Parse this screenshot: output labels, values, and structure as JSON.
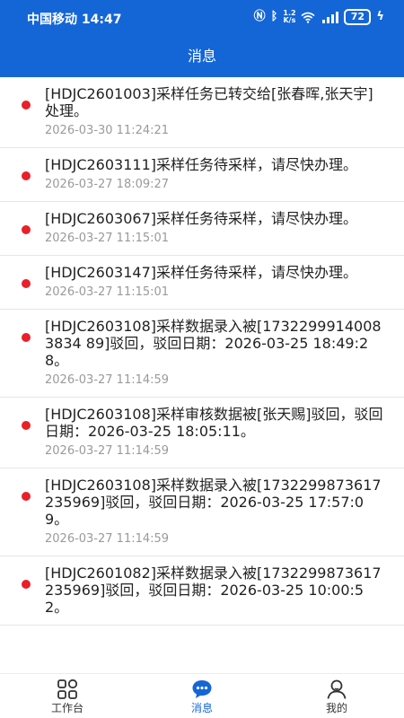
{
  "status_bar": {
    "carrier_time": "中国移动 14:47",
    "net_speed_top": "1.2",
    "net_speed_bottom": "K/s",
    "battery": "72"
  },
  "header": {
    "title": "消息"
  },
  "messages": [
    {
      "text": "[HDJC2601003]采样任务已转交给[张春晖,张天宇]处理。",
      "time": "2026-03-30 11:24:21"
    },
    {
      "text": "[HDJC2603111]采样任务待采样，请尽快办理。",
      "time": "2026-03-27 18:09:27"
    },
    {
      "text": "[HDJC2603067]采样任务待采样，请尽快办理。",
      "time": "2026-03-27 11:15:01"
    },
    {
      "text": "[HDJC2603147]采样任务待采样，请尽快办理。",
      "time": "2026-03-27 11:15:01"
    },
    {
      "text": "[HDJC2603108]采样数据录入被[17322999140083834 89]驳回，驳回日期：2026-03-25 18:49:28。",
      "time": "2026-03-27 11:14:59"
    },
    {
      "text": "[HDJC2603108]采样审核数据被[张天赐]驳回，驳回日期：2026-03-25 18:05:11。",
      "time": "2026-03-27 11:14:59"
    },
    {
      "text": "[HDJC2603108]采样数据录入被[1732299873617235969]驳回，驳回日期：2026-03-25 17:57:09。",
      "time": "2026-03-27 11:14:59"
    },
    {
      "text": "[HDJC2601082]采样数据录入被[1732299873617235969]驳回，驳回日期：2026-03-25 10:00:52。",
      "time": ""
    }
  ],
  "tabs": [
    {
      "label": "工作台",
      "icon": "grid-icon",
      "active": false
    },
    {
      "label": "消息",
      "icon": "message-icon",
      "active": true
    },
    {
      "label": "我的",
      "icon": "user-icon",
      "active": false
    }
  ],
  "colors": {
    "primary": "#1466d6",
    "unread_dot": "#e8202a",
    "time_text": "#9a9a9a"
  }
}
